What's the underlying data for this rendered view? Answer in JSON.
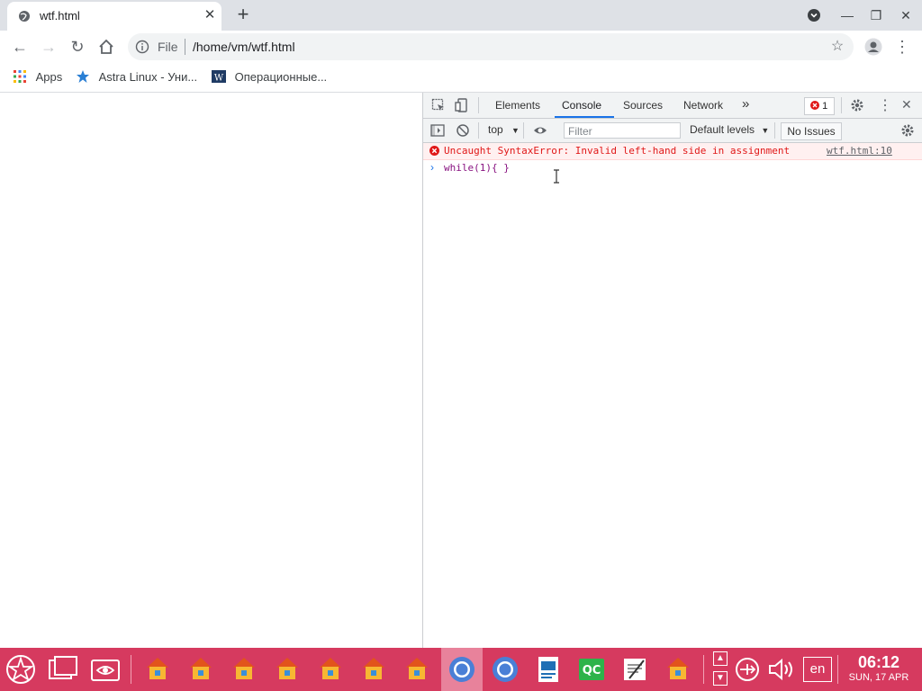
{
  "tab": {
    "title": "wtf.html"
  },
  "omnibox": {
    "scheme": "File",
    "url": "/home/vm/wtf.html"
  },
  "bookmarks": [
    {
      "label": "Apps"
    },
    {
      "label": "Astra Linux - Уни..."
    },
    {
      "label": "Операционные..."
    }
  ],
  "devtools": {
    "tabs": [
      "Elements",
      "Console",
      "Sources",
      "Network"
    ],
    "active_tab": "Console",
    "error_count": "1",
    "context": "top",
    "filter_placeholder": "Filter",
    "levels": "Default levels",
    "issues": "No Issues",
    "error_message": "Uncaught SyntaxError: Invalid left-hand side in assignment",
    "error_source": "wtf.html:10",
    "input": "while(1){ }"
  },
  "taskbar": {
    "lang": "en",
    "time": "06:12",
    "date": "SUN, 17 APR"
  },
  "colors": {
    "taskbar": "#d63a5f",
    "accent": "#1a73e8",
    "error": "#e01818"
  }
}
